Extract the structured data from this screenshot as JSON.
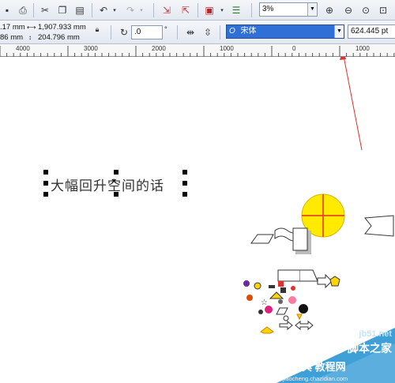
{
  "toolbar": {
    "zoom_value": "3%",
    "rotation_value": ".0",
    "degree_symbol": "°",
    "font_name": "宋体",
    "font_size": "624.445 pt"
  },
  "properties": {
    "x_value": ".17 mm",
    "y_value": "86 mm",
    "width_value": "1,907.933 mm",
    "height_value": "204.796 mm"
  },
  "ruler": {
    "labels": [
      "4000",
      "3000",
      "2000",
      "1000",
      "0",
      "1000"
    ]
  },
  "document": {
    "text": "大幅回升空间的话"
  },
  "watermark": {
    "site": "jb51.net",
    "tagline": "脚本之家",
    "label": "查字典 教程网",
    "url": "jiaocheng.chazidian.com"
  },
  "colors": {
    "annotation_arrow": "#e03030",
    "highlight": "#ffea00",
    "selection_fill": "#2f6fd6"
  }
}
